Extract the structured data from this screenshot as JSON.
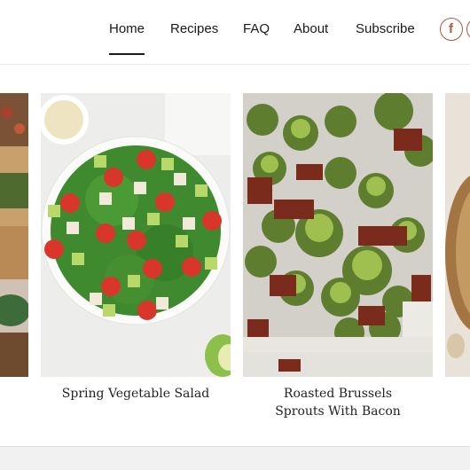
{
  "nav": {
    "items": [
      {
        "label": "Home",
        "active": true
      },
      {
        "label": "Recipes"
      },
      {
        "label": "FAQ"
      },
      {
        "label": "About"
      },
      {
        "label": "Subscribe"
      }
    ],
    "social": [
      {
        "icon": "facebook-icon",
        "glyph": "f"
      },
      {
        "icon": "social-icon"
      }
    ],
    "accent_color": "#b2583a"
  },
  "carousel": {
    "cards": [
      {
        "title": "",
        "image": "food-photo-partial-left"
      },
      {
        "title": "Spring Vegetable Salad",
        "image": "salad-bowl-photo"
      },
      {
        "title": "Roasted Brussels Sprouts With Bacon",
        "image": "brussels-sprouts-photo"
      },
      {
        "title": "",
        "image": "bread-photo-partial-right"
      }
    ]
  }
}
